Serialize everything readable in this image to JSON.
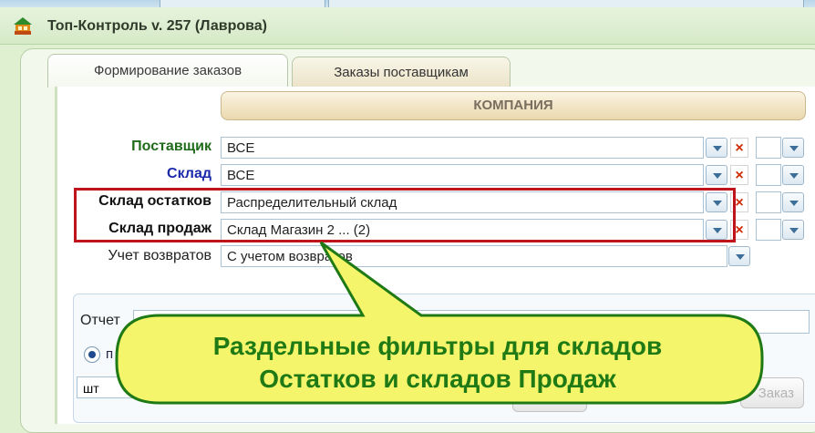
{
  "window": {
    "title": "Топ-Контроль v. 257 (Лаврова)"
  },
  "tabs": [
    {
      "label": "Формирование заказов",
      "active": true
    },
    {
      "label": "Заказы поставщикам",
      "active": false
    }
  ],
  "company_header": "КОМПАНИЯ",
  "filters": [
    {
      "label": "Поставщик",
      "value": "ВСЕ",
      "label_color": "#1f6b1a",
      "bold": true
    },
    {
      "label": "Склад",
      "value": "ВСЕ",
      "label_color": "#1a2aa8",
      "bold": true
    },
    {
      "label": "Склад остатков",
      "value": "Распределительный склад",
      "label_color": "#111111",
      "bold": true
    },
    {
      "label": "Склад продаж",
      "value": "Склад Магазин 2 ... (2)",
      "label_color": "#111111",
      "bold": true
    },
    {
      "label": "Учет возвратов",
      "value": "С учетом возвратов",
      "label_color": "#222222",
      "bold": false
    }
  ],
  "report": {
    "label": "Отчет",
    "radio_label": "п",
    "unit_value": "шт"
  },
  "order_button": "Заказ",
  "callout": {
    "line1": "Раздельные фильтры для складов",
    "line2": "Остатков и складов Продаж",
    "fill": "#f4f56a",
    "border": "#1f7a16",
    "text_color": "#1f7a16"
  },
  "highlight_color": "#c0141c"
}
